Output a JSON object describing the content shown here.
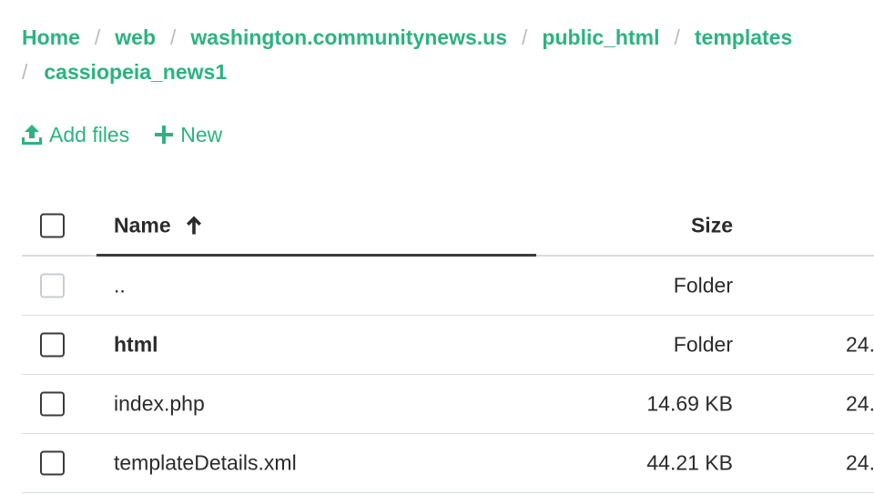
{
  "breadcrumb": {
    "items": [
      "Home",
      "web",
      "washington.communitynews.us",
      "public_html",
      "templates",
      "cassiopeia_news1"
    ],
    "separator": "/"
  },
  "toolbar": {
    "add_files_label": "Add files",
    "new_label": "New"
  },
  "table": {
    "columns": {
      "name": "Name",
      "size": "Size"
    },
    "rows": [
      {
        "name": "..",
        "size": "Folder",
        "date": ""
      },
      {
        "name": "html",
        "size": "Folder",
        "date": "24."
      },
      {
        "name": "index.php",
        "size": "14.69 KB",
        "date": "24."
      },
      {
        "name": "templateDetails.xml",
        "size": "44.21 KB",
        "date": "24."
      }
    ]
  },
  "colors": {
    "accent": "#2bb381",
    "separator": "#b8bcc0",
    "text": "#2b2b2b",
    "border": "#d9dcdf"
  },
  "icons": {
    "add_files": "upload-icon",
    "new": "plus-icon",
    "sort": "arrow-up-icon"
  }
}
